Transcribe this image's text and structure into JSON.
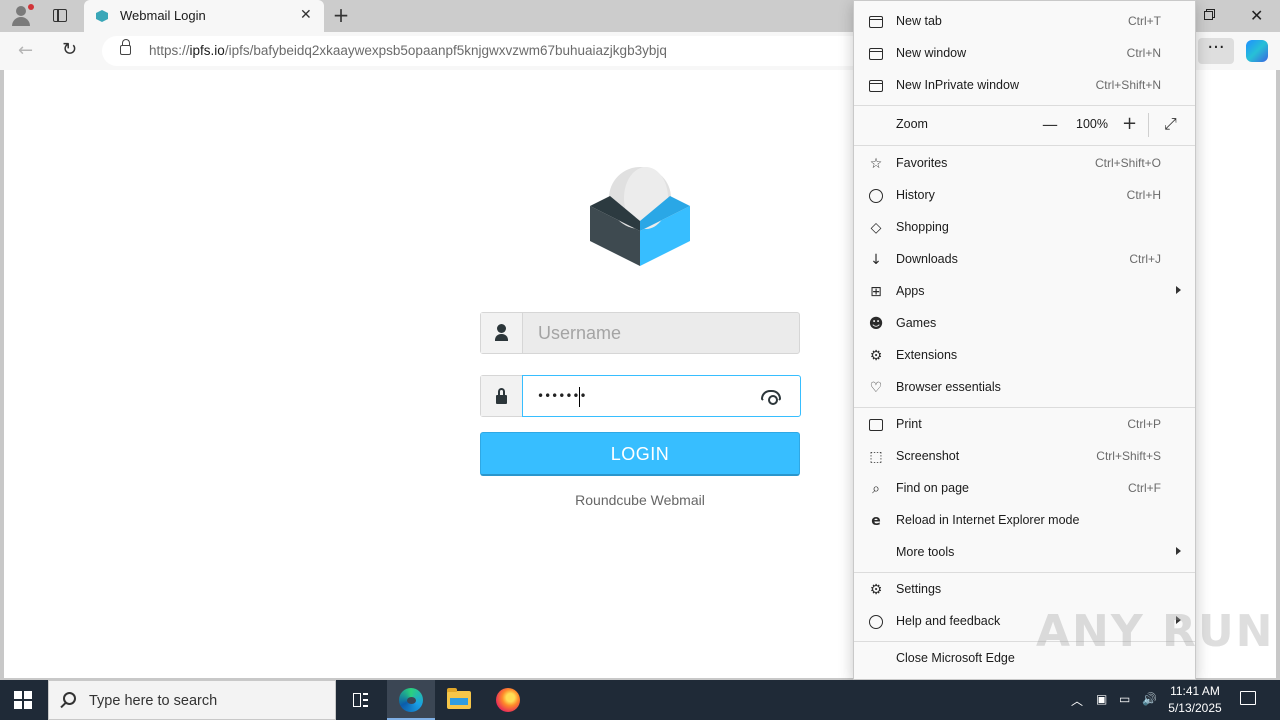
{
  "browser": {
    "tab_title": "Webmail Login",
    "tab_close_glyph": "✕",
    "new_tab_glyph": "+",
    "url_scheme": "https://",
    "url_host": "ipfs.io",
    "url_path": "/ipfs/bafybeidq2xkaaywexpsb5opaanpf5knjgwxvzwm67buhuaiazjkgb3ybjq",
    "more_glyph": "···",
    "window_close_glyph": "✕"
  },
  "login": {
    "username_placeholder": "Username",
    "password_value": "•••••••",
    "button_label": "LOGIN",
    "product_name": "Roundcube Webmail"
  },
  "menu": {
    "items": [
      {
        "label": "New tab",
        "shortcut": "Ctrl+T",
        "icon": "new-tab-icon"
      },
      {
        "label": "New window",
        "shortcut": "Ctrl+N",
        "icon": "new-window-icon"
      },
      {
        "label": "New InPrivate window",
        "shortcut": "Ctrl+Shift+N",
        "icon": "inprivate-icon"
      },
      {
        "label": "Zoom",
        "value": "100%",
        "icon": "none"
      },
      {
        "label": "Favorites",
        "shortcut": "Ctrl+Shift+O",
        "icon": "star-icon"
      },
      {
        "label": "History",
        "shortcut": "Ctrl+H",
        "icon": "history-icon"
      },
      {
        "label": "Shopping",
        "shortcut": "",
        "icon": "tag-icon"
      },
      {
        "label": "Downloads",
        "shortcut": "Ctrl+J",
        "icon": "download-icon"
      },
      {
        "label": "Apps",
        "shortcut": "",
        "icon": "apps-icon"
      },
      {
        "label": "Games",
        "shortcut": "",
        "icon": "gamepad-icon"
      },
      {
        "label": "Extensions",
        "shortcut": "",
        "icon": "puzzle-icon"
      },
      {
        "label": "Browser essentials",
        "shortcut": "",
        "icon": "heartbeat-icon"
      },
      {
        "label": "Print",
        "shortcut": "Ctrl+P",
        "icon": "printer-icon"
      },
      {
        "label": "Screenshot",
        "shortcut": "Ctrl+Shift+S",
        "icon": "screenshot-icon"
      },
      {
        "label": "Find on page",
        "shortcut": "Ctrl+F",
        "icon": "find-icon"
      },
      {
        "label": "Reload in Internet Explorer mode",
        "shortcut": "",
        "icon": "ie-icon"
      },
      {
        "label": "More tools",
        "shortcut": "",
        "icon": "none"
      },
      {
        "label": "Settings",
        "shortcut": "",
        "icon": "gear-icon"
      },
      {
        "label": "Help and feedback",
        "shortcut": "",
        "icon": "help-icon"
      },
      {
        "label": "Close Microsoft Edge",
        "shortcut": "",
        "icon": "none"
      }
    ]
  },
  "watermark": "ANY RUN",
  "taskbar": {
    "search_placeholder": "Type here to search",
    "time": "11:41 AM",
    "date": "5/13/2025"
  },
  "colors": {
    "accent": "#37beff",
    "taskbar": "#1f2a37",
    "logo_dark": "#2c3a40"
  }
}
